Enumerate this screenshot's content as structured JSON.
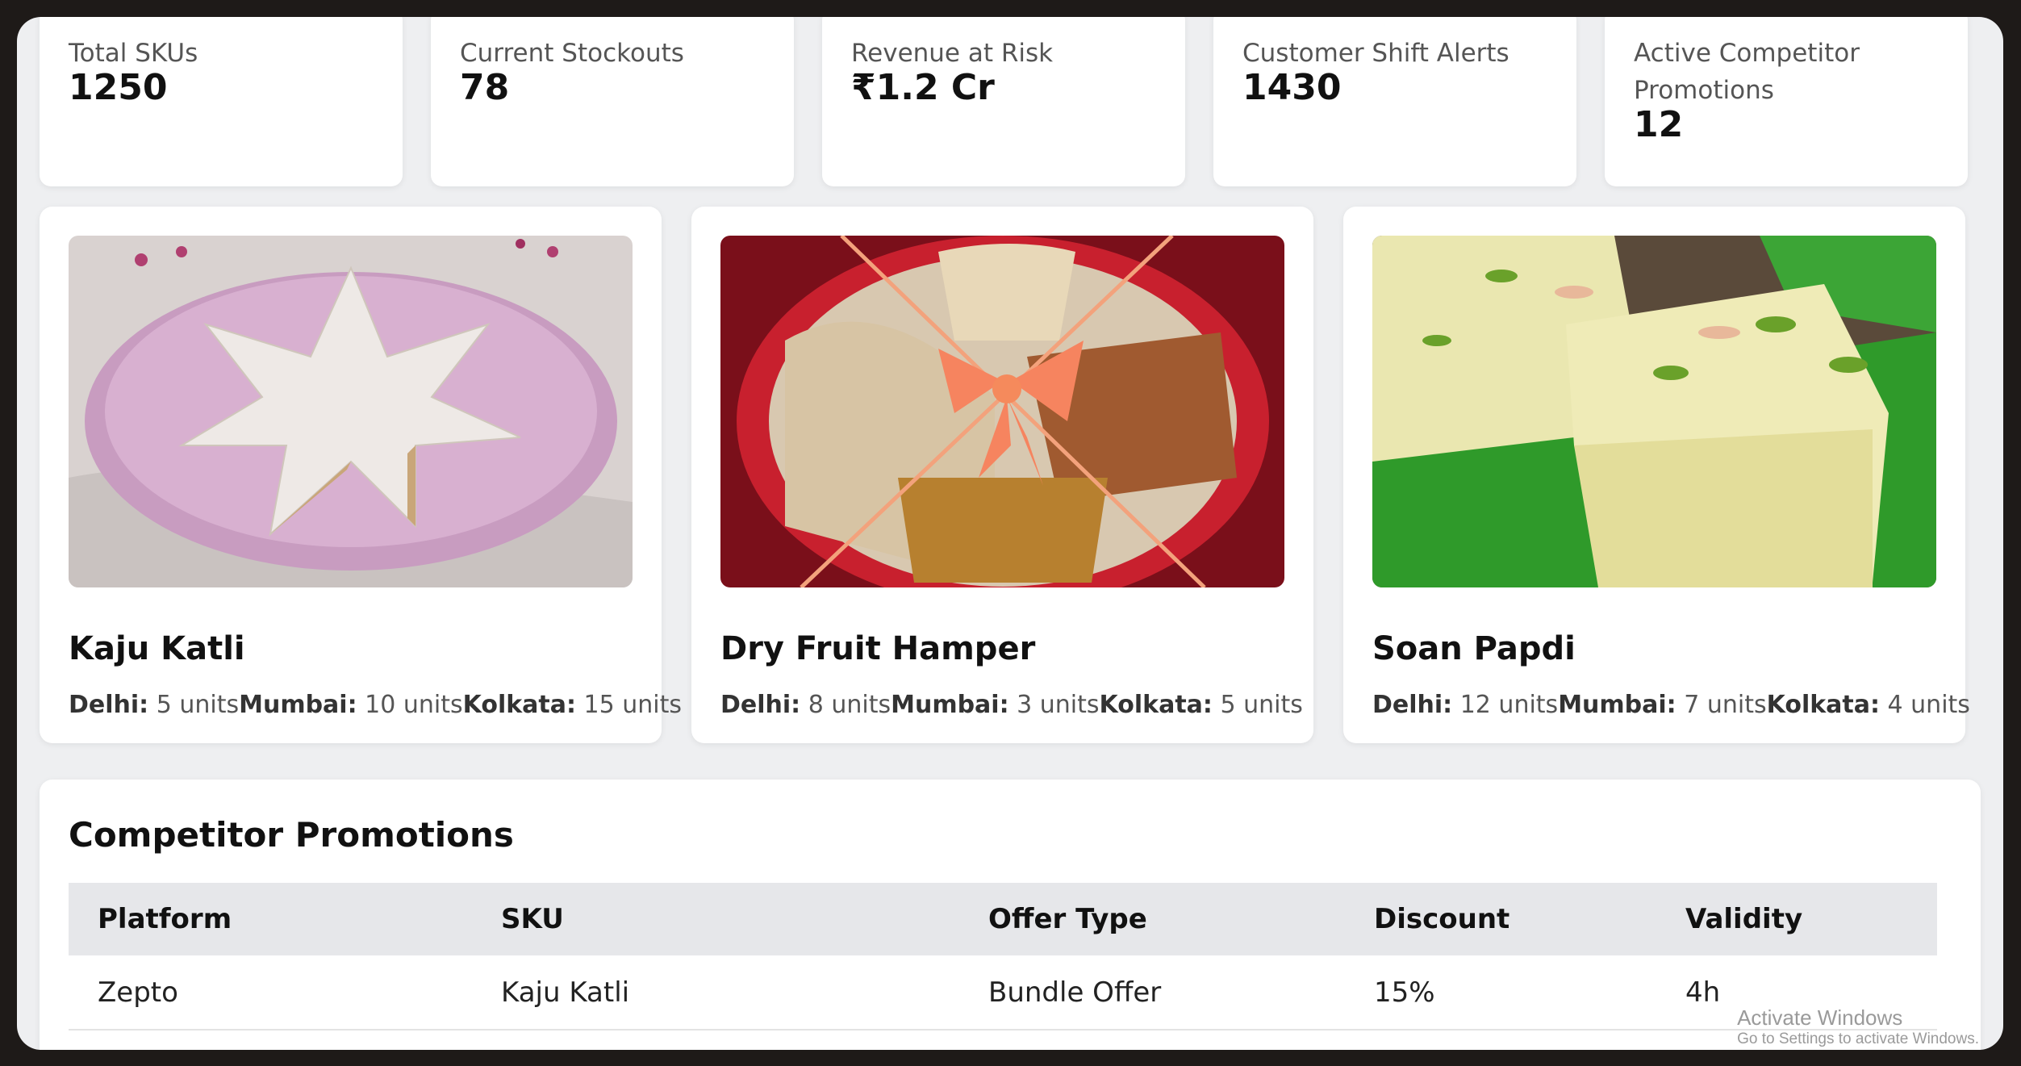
{
  "kpis": [
    {
      "label": "Total SKUs",
      "value": "1250"
    },
    {
      "label": "Current Stockouts",
      "value": "78"
    },
    {
      "label": "Revenue at Risk",
      "value": "₹1.2 Cr"
    },
    {
      "label": "Customer Shift Alerts",
      "value": "1430"
    },
    {
      "label": "Active Competitor Promotions",
      "value": "12"
    }
  ],
  "products": [
    {
      "name": "Kaju Katli",
      "stock": [
        {
          "city": "Delhi:",
          "units": "5 units"
        },
        {
          "city": "Mumbai:",
          "units": "10 units"
        },
        {
          "city": "Kolkata:",
          "units": "15 units"
        }
      ]
    },
    {
      "name": "Dry Fruit Hamper",
      "stock": [
        {
          "city": "Delhi:",
          "units": "8 units"
        },
        {
          "city": "Mumbai:",
          "units": "3 units"
        },
        {
          "city": "Kolkata:",
          "units": "5 units"
        }
      ]
    },
    {
      "name": "Soan Papdi",
      "stock": [
        {
          "city": "Delhi:",
          "units": "12 units"
        },
        {
          "city": "Mumbai:",
          "units": "7 units"
        },
        {
          "city": "Kolkata:",
          "units": "4 units"
        }
      ]
    }
  ],
  "promotions": {
    "title": "Competitor Promotions",
    "headers": [
      "Platform",
      "SKU",
      "Offer Type",
      "Discount",
      "Validity"
    ],
    "rows": [
      [
        "Zepto",
        "Kaju Katli",
        "Bundle Offer",
        "15%",
        "4h"
      ]
    ]
  },
  "watermark": {
    "line1": "Activate Windows",
    "line2": "Go to Settings to activate Windows."
  }
}
